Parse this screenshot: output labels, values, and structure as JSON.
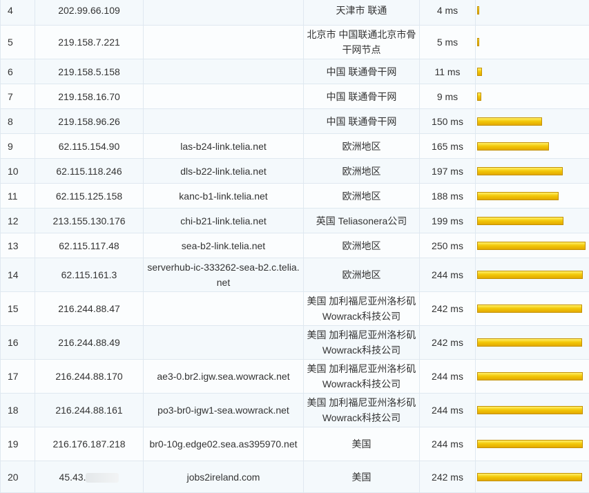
{
  "rows": [
    {
      "hop": "4",
      "ip": "202.99.66.109",
      "host": "",
      "location": "天津市 联通",
      "latency": "4 ms",
      "latency_ms": 4
    },
    {
      "hop": "5",
      "ip": "219.158.7.221",
      "host": "",
      "location": "北京市 中国联通北京市骨干网节点",
      "latency": "5 ms",
      "latency_ms": 5
    },
    {
      "hop": "6",
      "ip": "219.158.5.158",
      "host": "",
      "location": "中国 联通骨干网",
      "latency": "11 ms",
      "latency_ms": 11
    },
    {
      "hop": "7",
      "ip": "219.158.16.70",
      "host": "",
      "location": "中国 联通骨干网",
      "latency": "9 ms",
      "latency_ms": 9
    },
    {
      "hop": "8",
      "ip": "219.158.96.26",
      "host": "",
      "location": "中国 联通骨干网",
      "latency": "150 ms",
      "latency_ms": 150
    },
    {
      "hop": "9",
      "ip": "62.115.154.90",
      "host": "las-b24-link.telia.net",
      "location": "欧洲地区",
      "latency": "165 ms",
      "latency_ms": 165
    },
    {
      "hop": "10",
      "ip": "62.115.118.246",
      "host": "dls-b22-link.telia.net",
      "location": "欧洲地区",
      "latency": "197 ms",
      "latency_ms": 197
    },
    {
      "hop": "11",
      "ip": "62.115.125.158",
      "host": "kanc-b1-link.telia.net",
      "location": "欧洲地区",
      "latency": "188 ms",
      "latency_ms": 188
    },
    {
      "hop": "12",
      "ip": "213.155.130.176",
      "host": "chi-b21-link.telia.net",
      "location": "英国 Teliasonera公司",
      "latency": "199 ms",
      "latency_ms": 199
    },
    {
      "hop": "13",
      "ip": "62.115.117.48",
      "host": "sea-b2-link.telia.net",
      "location": "欧洲地区",
      "latency": "250 ms",
      "latency_ms": 250
    },
    {
      "hop": "14",
      "ip": "62.115.161.3",
      "host": "serverhub-ic-333262-sea-b2.c.telia.net",
      "location": "欧洲地区",
      "latency": "244 ms",
      "latency_ms": 244
    },
    {
      "hop": "15",
      "ip": "216.244.88.47",
      "host": "",
      "location": "美国 加利福尼亚州洛杉矶Wowrack科技公司",
      "latency": "242 ms",
      "latency_ms": 242
    },
    {
      "hop": "16",
      "ip": "216.244.88.49",
      "host": "",
      "location": "美国 加利福尼亚州洛杉矶Wowrack科技公司",
      "latency": "242 ms",
      "latency_ms": 242
    },
    {
      "hop": "17",
      "ip": "216.244.88.170",
      "host": "ae3-0.br2.igw.sea.wowrack.net",
      "location": "美国 加利福尼亚州洛杉矶Wowrack科技公司",
      "latency": "244 ms",
      "latency_ms": 244
    },
    {
      "hop": "18",
      "ip": "216.244.88.161",
      "host": "po3-br0-igw1-sea.wowrack.net",
      "location": "美国 加利福尼亚州洛杉矶Wowrack科技公司",
      "latency": "244 ms",
      "latency_ms": 244
    },
    {
      "hop": "19",
      "ip": "216.176.187.218",
      "host": "br0-10g.edge02.sea.as395970.net",
      "location": "美国",
      "latency": "244 ms",
      "latency_ms": 244
    },
    {
      "hop": "20",
      "ip": "45.43.",
      "host": "jobs2ireland.com",
      "location": "美国",
      "latency": "242 ms",
      "latency_ms": 242
    }
  ],
  "max_latency_ms": 250,
  "bar_color": "#f3c90a",
  "masked_ip_hop": "20"
}
